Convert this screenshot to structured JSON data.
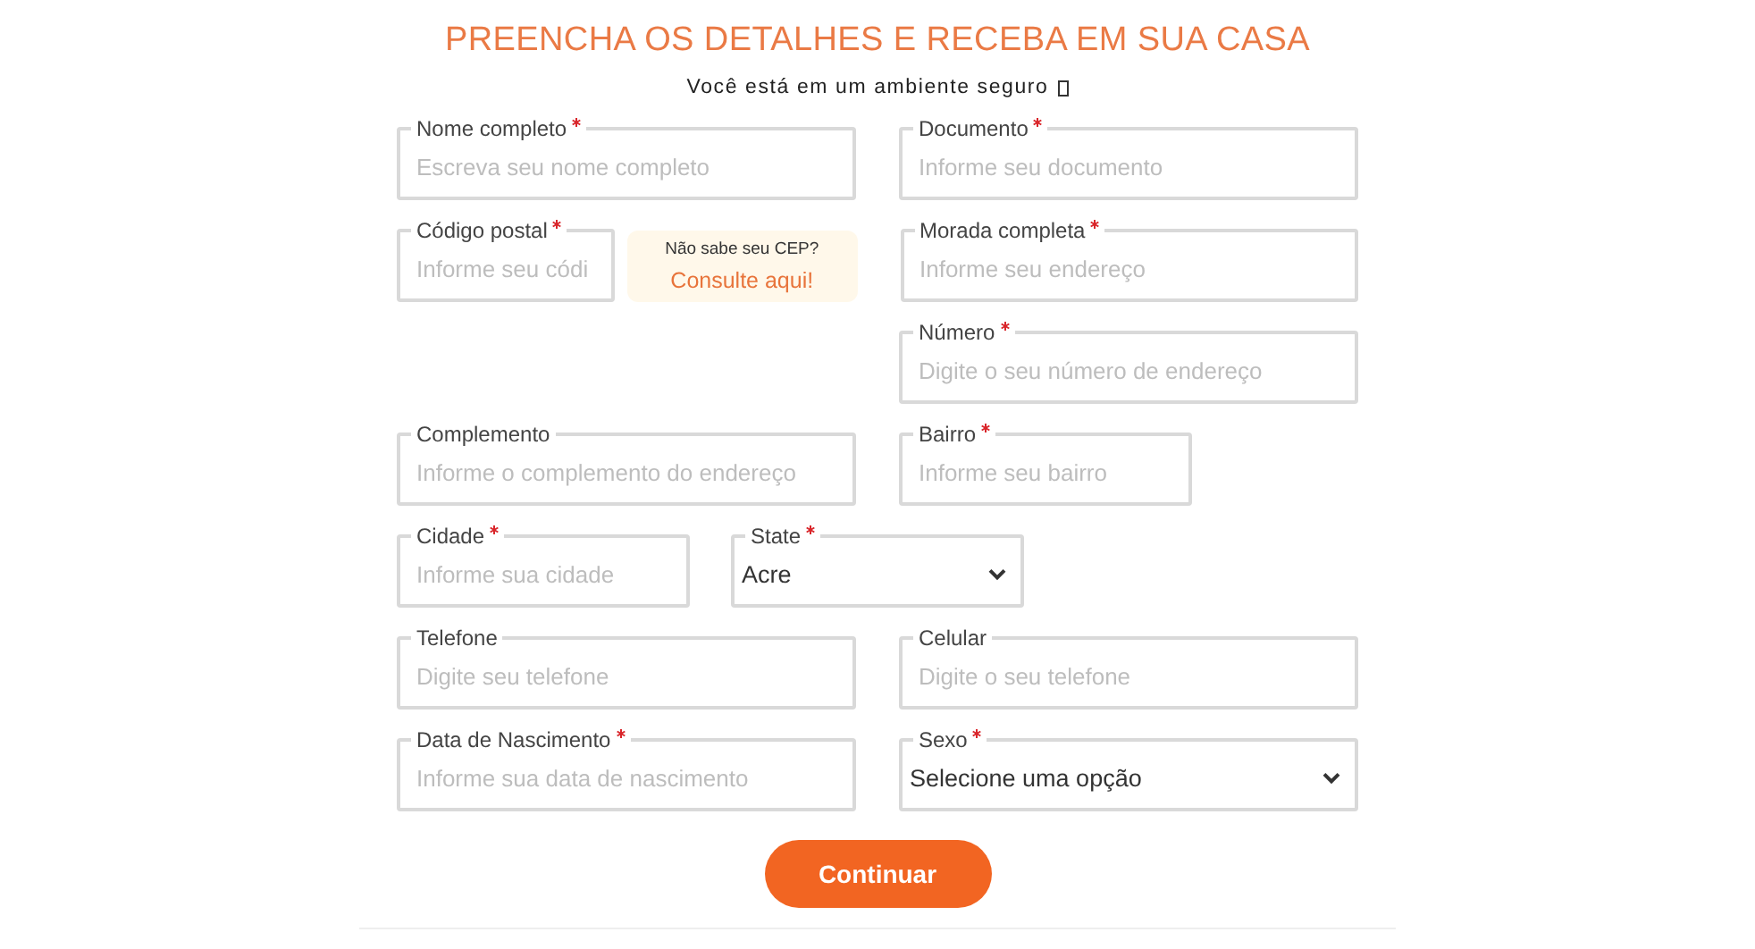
{
  "heading": "PREENCHA OS DETALHES E RECEBA EM SUA CASA",
  "subheading": "Você está em um ambiente seguro",
  "rows": [
    {
      "fields": [
        {
          "kind": "input",
          "label": "Nome completo",
          "required": true,
          "placeholder": "Escreva seu nome completo"
        },
        {
          "kind": "input",
          "label": "Documento",
          "required": true,
          "placeholder": "Informe seu documento"
        }
      ]
    },
    {
      "fields": [
        {
          "kind": "input",
          "label": "Código postal",
          "required": true,
          "placeholder": "Informe seu códi"
        },
        {
          "kind": "help",
          "question": "Não sabe seu CEP?",
          "link": "Consulte aqui!"
        },
        {
          "kind": "input",
          "label": "Morada completa",
          "required": true,
          "placeholder": "Informe seu endereço"
        }
      ]
    },
    {
      "fields": [
        {
          "kind": "input",
          "label": "Número",
          "required": true,
          "placeholder": "Digite o seu número de endereço"
        }
      ]
    },
    {
      "fields": [
        {
          "kind": "input",
          "label": "Complemento",
          "required": false,
          "placeholder": "Informe o complemento do endereço"
        },
        {
          "kind": "input",
          "label": "Bairro",
          "required": true,
          "placeholder": "Informe seu bairro"
        }
      ]
    },
    {
      "fields": [
        {
          "kind": "input",
          "label": "Cidade",
          "required": true,
          "placeholder": "Informe sua cidade"
        },
        {
          "kind": "select",
          "label": "State",
          "required": true,
          "value": "Acre"
        }
      ]
    },
    {
      "fields": [
        {
          "kind": "input",
          "label": "Telefone",
          "required": false,
          "placeholder": "Digite seu telefone"
        },
        {
          "kind": "input",
          "label": "Celular",
          "required": false,
          "placeholder": "Digite o seu telefone"
        }
      ]
    },
    {
      "fields": [
        {
          "kind": "input",
          "label": "Data de Nascimento",
          "required": true,
          "placeholder": "Informe sua data de nascimento"
        },
        {
          "kind": "select",
          "label": "Sexo",
          "required": true,
          "value": "Selecione uma opção"
        }
      ]
    }
  ],
  "submit": "Continuar"
}
